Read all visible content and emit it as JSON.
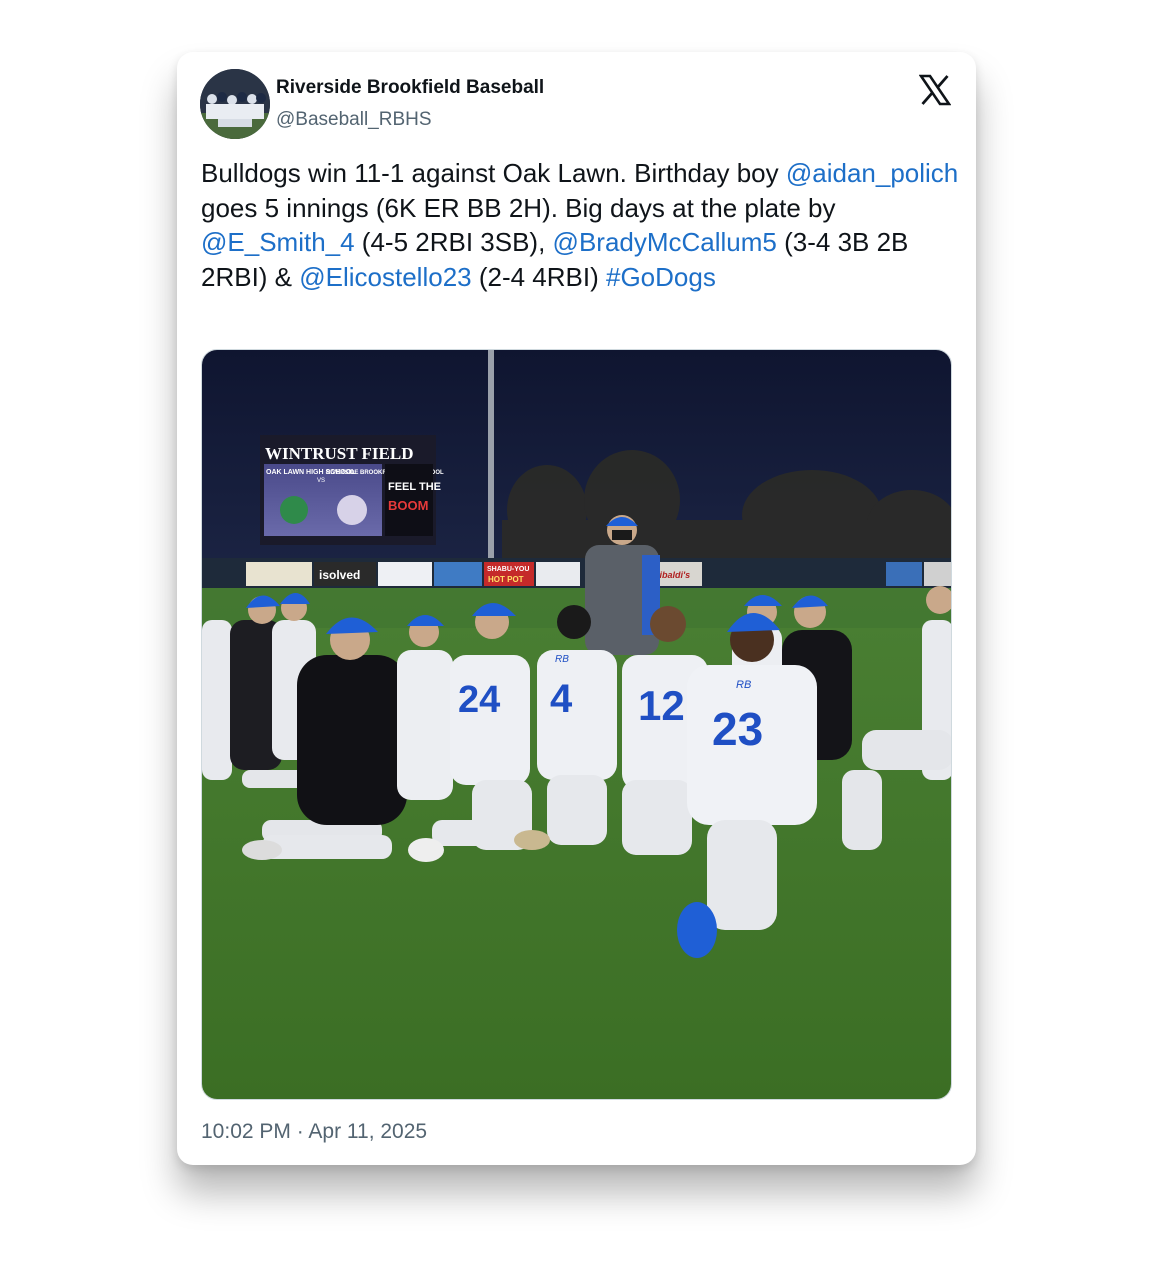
{
  "author": {
    "name": "Riverside Brookfield Baseball",
    "handle": "@Baseball_RBHS"
  },
  "icons": {
    "platform": "x-logo-icon",
    "avatar": "team-photo-avatar"
  },
  "tweet": {
    "segments": [
      {
        "text": "Bulldogs win 11-1 against Oak Lawn. Birthday boy ",
        "type": "text"
      },
      {
        "text": "@aidan_polich",
        "type": "mention"
      },
      {
        "text": " goes 5 innings (6K ER BB 2H). Big days at the plate by ",
        "type": "text"
      },
      {
        "text": "@E_Smith_4",
        "type": "mention"
      },
      {
        "text": " (4-5 2RBI 3SB), ",
        "type": "text"
      },
      {
        "text": "@BradyMcCallum5",
        "type": "mention"
      },
      {
        "text": " (3-4 3B 2B 2RBI) & ",
        "type": "text"
      },
      {
        "text": "@Elicostello23",
        "type": "mention"
      },
      {
        "text": " (2-4 4RBI) ",
        "type": "text"
      },
      {
        "text": "#GoDogs",
        "type": "hashtag"
      }
    ]
  },
  "photo": {
    "scoreboard_title": "WINTRUST FIELD",
    "team_left": "OAK LAWN HIGH SCHOOL",
    "versus": "VS",
    "team_right": "RIVERSIDE BROOKFIELD HIGH SCHOOL",
    "slogan_top": "FEEL THE",
    "slogan_bottom": "BOOM",
    "jersey_numbers": [
      "24",
      "4",
      "12",
      "23"
    ],
    "jersey_letters": "RB",
    "ads": [
      "isolved",
      "SHABU-YOU",
      "HOT POT",
      "Garibaldi's"
    ]
  },
  "timestamp": "10:02 PM · Apr 11, 2025",
  "colors": {
    "link": "#1d6fc8",
    "text": "#0f1419",
    "secondary": "#536471",
    "sky": "#141b33",
    "grass": "#3f7a2c",
    "cap_blue": "#1f5fd6"
  }
}
